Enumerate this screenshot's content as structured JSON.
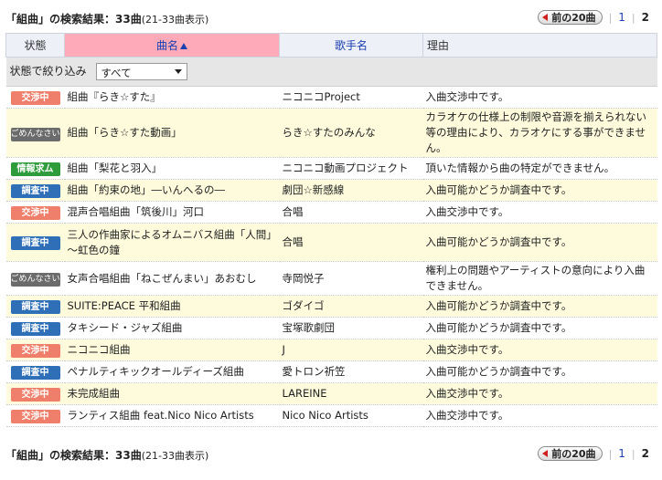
{
  "header": {
    "title": "「組曲」の検索結果：33曲",
    "range": "(21-33曲表示)"
  },
  "pager": {
    "prev_label": "前の20曲",
    "page1": "1",
    "page2": "2"
  },
  "table": {
    "columns": {
      "status": "状態",
      "song": "曲名",
      "artist": "歌手名",
      "reason": "理由"
    },
    "filter": {
      "label": "状態で絞り込み",
      "selected": "すべて"
    },
    "rows": [
      {
        "status": "交渉中",
        "status_type": "negotiating",
        "song": "組曲『らき☆すた』",
        "artist": "ニコニコProject",
        "reason": "入曲交渉中です。"
      },
      {
        "status": "ごめんなさい",
        "status_type": "sorry",
        "song": "組曲「らき☆すた動画」",
        "artist": "らき☆すたのみんな",
        "reason": "カラオケの仕様上の制限や音源を揃えられない等の理由により、カラオケにする事ができません。"
      },
      {
        "status": "情報求ム",
        "status_type": "info",
        "song": "組曲「梨花と羽入」",
        "artist": "ニコニコ動画プロジェクト",
        "reason": "頂いた情報から曲の特定ができません。"
      },
      {
        "status": "調査中",
        "status_type": "investigating",
        "song": "組曲「約束の地」―いんへるの―",
        "artist": "劇団☆新感線",
        "reason": "入曲可能かどうか調査中です。"
      },
      {
        "status": "交渉中",
        "status_type": "negotiating",
        "song": "混声合唱組曲「筑後川」河口",
        "artist": "合唱",
        "reason": "入曲交渉中です。"
      },
      {
        "status": "調査中",
        "status_type": "investigating",
        "song": "三人の作曲家によるオムニバス組曲「人間」～虹色の鐘",
        "artist": "合唱",
        "reason": "入曲可能かどうか調査中です。"
      },
      {
        "status": "ごめんなさい",
        "status_type": "sorry",
        "song": "女声合唱組曲「ねこぜんまい」あおむし",
        "artist": "寺岡悦子",
        "reason": "権利上の問題やアーティストの意向により入曲できません。"
      },
      {
        "status": "調査中",
        "status_type": "investigating",
        "song": "SUITE:PEACE 平和組曲",
        "artist": "ゴダイゴ",
        "reason": "入曲可能かどうか調査中です。"
      },
      {
        "status": "調査中",
        "status_type": "investigating",
        "song": "タキシード・ジャズ組曲",
        "artist": "宝塚歌劇団",
        "reason": "入曲可能かどうか調査中です。"
      },
      {
        "status": "交渉中",
        "status_type": "negotiating",
        "song": "ニコニコ組曲",
        "artist": "J",
        "reason": "入曲交渉中です。"
      },
      {
        "status": "調査中",
        "status_type": "investigating",
        "song": "ペナルティキックオールディーズ組曲",
        "artist": "愛トロン祈笠",
        "reason": "入曲可能かどうか調査中です。"
      },
      {
        "status": "交渉中",
        "status_type": "negotiating",
        "song": "未完成組曲",
        "artist": "LAREINE",
        "reason": "入曲交渉中です。"
      },
      {
        "status": "交渉中",
        "status_type": "negotiating",
        "song": "ランティス組曲 feat.Nico Nico Artists",
        "artist": "Nico Nico Artists",
        "reason": "入曲交渉中です。"
      }
    ]
  }
}
